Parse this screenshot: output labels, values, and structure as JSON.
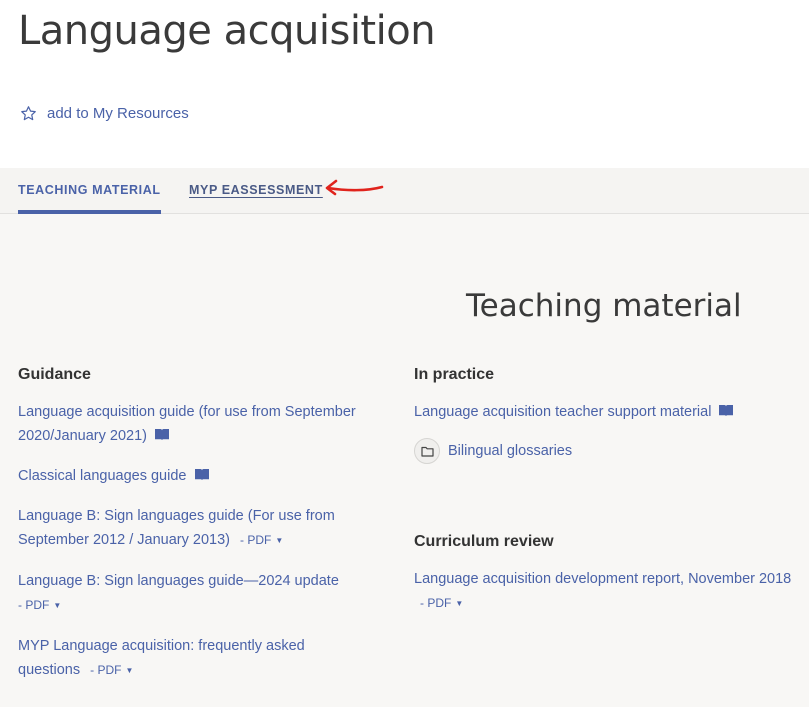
{
  "page": {
    "title": "Language acquisition"
  },
  "actions": {
    "add_to_resources": "add to My Resources"
  },
  "tabs": [
    {
      "label": "TEACHING MATERIAL",
      "active": true
    },
    {
      "label": "MYP EASSESSMENT",
      "active": false
    }
  ],
  "main": {
    "heading": "Teaching material",
    "guidance": {
      "title": "Guidance",
      "items": [
        {
          "label": "Language acquisition guide (for use from September 2020/January 2021)",
          "icon": "book-icon"
        },
        {
          "label": "Classical languages guide",
          "icon": "book-icon"
        },
        {
          "label": "Language B: Sign languages guide (For use from September 2012 / January 2013)",
          "pdf": "- PDF"
        },
        {
          "label": "Language B: Sign languages guide—2024 update",
          "pdf": "- PDF"
        },
        {
          "label": "MYP Language acquisition: frequently asked questions",
          "pdf": "- PDF"
        }
      ]
    },
    "in_practice": {
      "title": "In practice",
      "items": [
        {
          "label": "Language acquisition teacher support material",
          "icon": "book-icon"
        },
        {
          "label": "Bilingual glossaries",
          "icon": "folder-icon"
        }
      ]
    },
    "curriculum_review": {
      "title": "Curriculum review",
      "items": [
        {
          "label": "Language acquisition development report, November 2018",
          "pdf": "- PDF"
        }
      ]
    }
  },
  "colors": {
    "link": "#4a62a8",
    "annotation": "#e0231c",
    "tabs_bg": "#f5f4f2",
    "content_bg": "#f8f7f5"
  }
}
